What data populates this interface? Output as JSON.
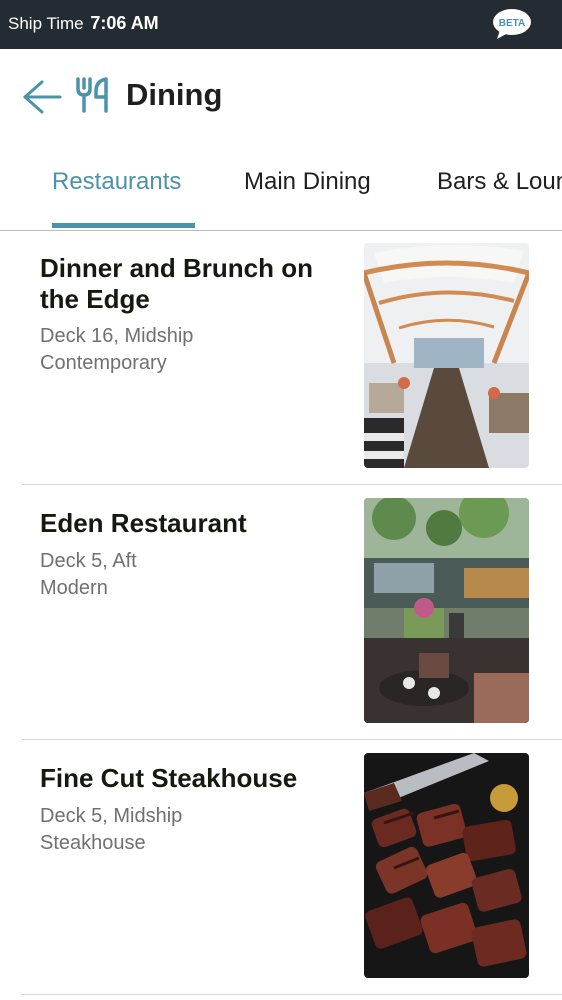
{
  "status_bar": {
    "label": "Ship Time",
    "time": "7:06 AM",
    "badge": "BETA"
  },
  "header": {
    "back_icon": "arrow-left-icon",
    "section_icon": "fork-knife-icon",
    "title": "Dining"
  },
  "tabs": [
    {
      "label": "Restaurants",
      "active": true
    },
    {
      "label": "Main Dining",
      "active": false
    },
    {
      "label": "Bars & Lounges",
      "active": false
    }
  ],
  "restaurants": [
    {
      "name": "Dinner and Brunch on the Edge",
      "location": "Deck 16, Midship",
      "cuisine": "Contemporary"
    },
    {
      "name": "Eden Restaurant",
      "location": "Deck 5, Aft",
      "cuisine": "Modern"
    },
    {
      "name": "Fine Cut Steakhouse",
      "location": "Deck 5, Midship",
      "cuisine": "Steakhouse"
    }
  ],
  "colors": {
    "status_bar_bg": "#252b32",
    "accent": "#4b93a8",
    "title_text": "#16190f",
    "meta_text": "#707070"
  }
}
